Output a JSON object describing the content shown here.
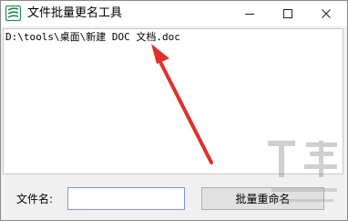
{
  "window": {
    "title": "文件批量更名工具",
    "controls": {
      "minimize_icon": "minimize-icon",
      "maximize_icon": "maximize-icon",
      "close_icon": "close-icon"
    }
  },
  "main": {
    "path_text": "D:\\tools\\桌面\\新建 DOC 文档.doc",
    "annotation_arrow_color": "#e0302a"
  },
  "form": {
    "filename_label": "文件名:",
    "filename_value": "",
    "rename_button_label": "批量重命名"
  },
  "colors": {
    "window_bg": "#f0f0f0",
    "titlebar_bg": "#ffffff",
    "input_border": "#7a9cd3",
    "button_bg": "#e1e1e1"
  }
}
